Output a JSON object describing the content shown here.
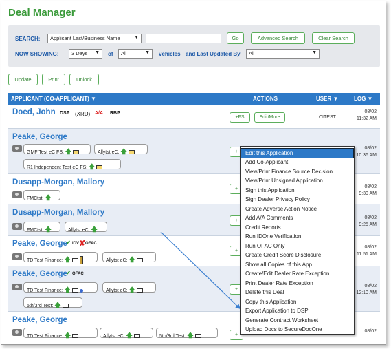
{
  "title": "Deal Manager",
  "search": {
    "label": "SEARCH:",
    "field_select": "Applicant Last/Business Name",
    "text_value": "",
    "go_label": "Go",
    "advanced_label": "Advanced Search",
    "clear_label": "Clear Search",
    "showing_label": "NOW SHOWING:",
    "days_select": "3 Days",
    "of_label": "of",
    "vehicles_select": "All",
    "vehicles_label": "vehicles",
    "updated_label": "and Last Updated By",
    "updated_select": "All"
  },
  "toolbar": {
    "update_label": "Update",
    "print_label": "Print",
    "unlock_label": "Unlock"
  },
  "table": {
    "col_applicant": "APPLICANT (CO-APPLICANT) ▼",
    "col_actions": "ACTIONS",
    "col_user": "USER ▼",
    "col_log": "LOG ▼"
  },
  "rows": [
    {
      "name": "Doed, John",
      "tags": [
        "DSP",
        "(XRD)",
        "A/A",
        "RBP"
      ],
      "fs_label": "+FS",
      "edit_label": "Edit/More",
      "user": "CITEST",
      "log_date": "08/02",
      "log_time": "11:32 AM"
    },
    {
      "name": "Peake, George",
      "pills": [
        "GMF Test eC FS:",
        "Allytst eC:",
        "R1 Independent Test eC FS:"
      ],
      "log_date": "08/02",
      "log_time": "10:36 AM"
    },
    {
      "name": "Dusapp-Morgan, Mallory",
      "pills": [
        "FMCtst:"
      ],
      "log_date": "08/02",
      "log_time": "9:30 AM"
    },
    {
      "name": "Dusapp-Morgan, Mallory",
      "pills": [
        "FMCtst:",
        "Allytst eC:"
      ],
      "log_date": "08/02",
      "log_time": "9:25 AM"
    },
    {
      "name": "Peake, George",
      "badges": [
        "IDV",
        "OFAC"
      ],
      "pills": [
        "TD Test Finance:",
        "Allytst eC:"
      ],
      "log_date": "08/02",
      "log_time": "11:51 AM"
    },
    {
      "name": "Peake, George",
      "badges": [
        "OFAC"
      ],
      "pills": [
        "TD Test Finance:",
        "Allytst eC:",
        "5th/3rd Test:"
      ],
      "log_date": "08/02",
      "log_time": "12:10 AM"
    },
    {
      "name": "Peake, George",
      "pills": [
        "TD Test Finance:",
        "Allytst eC:",
        "5th/3rd Test:"
      ],
      "log_date": "08/02",
      "log_time": ""
    }
  ],
  "context_menu": {
    "items": [
      "Edit this Application",
      "Add Co-Applicant",
      "View/Print Finance Source Decision",
      "View/Print Unsigned Application",
      "Sign this Application",
      "Sign Dealer Privacy Policy",
      "Create Adverse Action Notice",
      "Add A/A Comments",
      "Credit Reports",
      "Run IDOne Verification",
      "Run OFAC Only",
      "Create Credit Score Disclosure",
      "Show all Copies of this App",
      "Create/Edit Dealer Rate Exception",
      "Print Dealer Rate Exception",
      "Delete this Deal",
      "Copy this Application",
      "Export Application to DSP",
      "Generate Contract Worksheet",
      "Upload Docs to SecureDocOne"
    ],
    "selected": [
      "Edit this Application",
      "Upload Docs to SecureDocOne"
    ]
  },
  "colors": {
    "brand_green": "#3a9a3a",
    "header_blue": "#2d79c7",
    "link_blue": "#2d79c7",
    "panel_gray": "#e6e8ec"
  }
}
